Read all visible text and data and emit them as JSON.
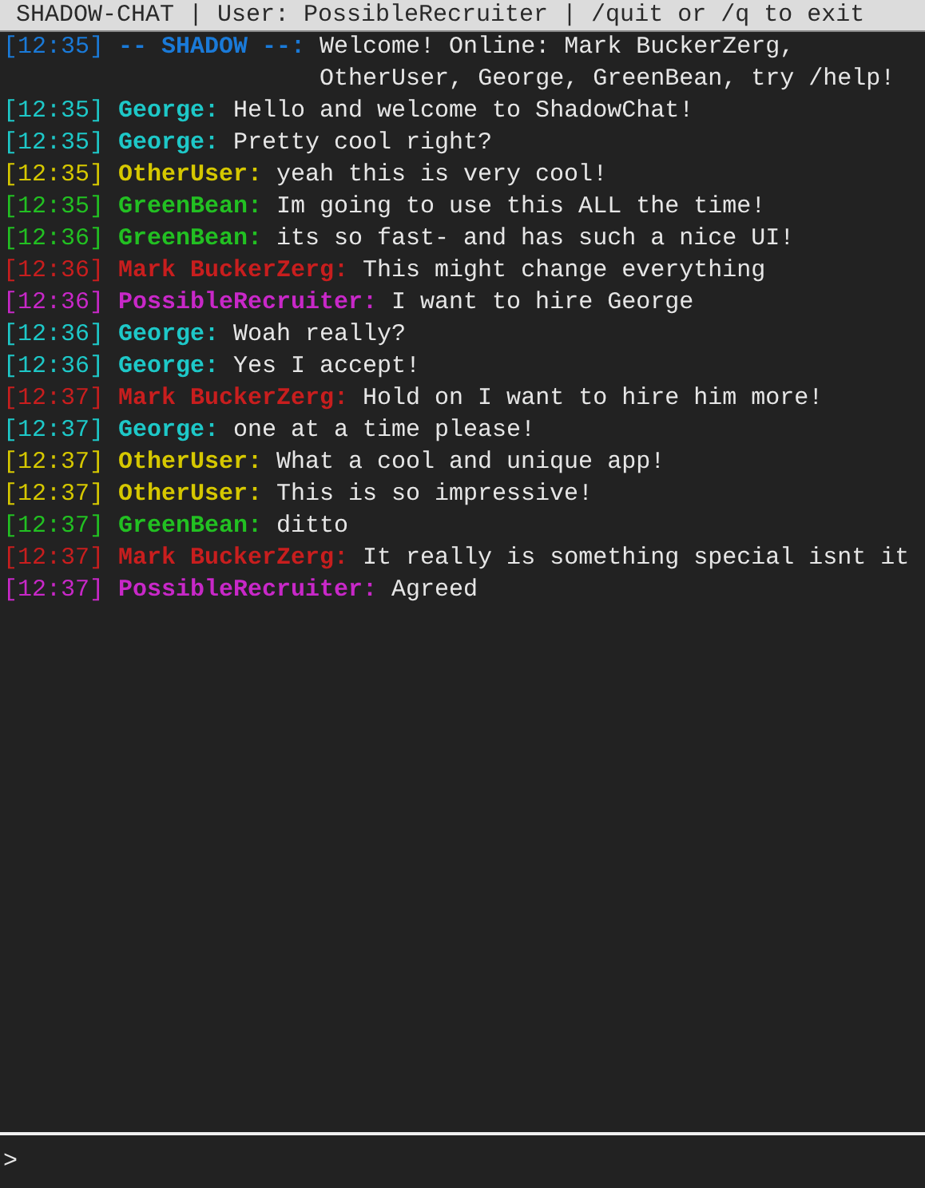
{
  "title_bar": "SHADOW-CHAT | User: PossibleRecruiter | /quit or /q to exit",
  "messages": [
    {
      "time": "[12:35]",
      "name": "-- SHADOW --:",
      "color": "#1a7ad8",
      "text": "Welcome! Online: Mark BuckerZerg, OtherUser, George, GreenBean, try /help!"
    },
    {
      "time": "[12:35]",
      "name": "George:",
      "color": "#1ec8c8",
      "text": "Hello and welcome to ShadowChat!"
    },
    {
      "time": "[12:35]",
      "name": "George:",
      "color": "#1ec8c8",
      "text": "Pretty cool right?"
    },
    {
      "time": "[12:35]",
      "name": "OtherUser:",
      "color": "#d6c800",
      "text": "yeah this is very cool!"
    },
    {
      "time": "[12:35]",
      "name": "GreenBean:",
      "color": "#22c022",
      "text": "Im going to use this ALL the time!"
    },
    {
      "time": "[12:36]",
      "name": "GreenBean:",
      "color": "#22c022",
      "text": "its so fast- and has such a nice UI!"
    },
    {
      "time": "[12:36]",
      "name": "Mark BuckerZerg:",
      "color": "#c81e1e",
      "text": "This might change everything"
    },
    {
      "time": "[12:36]",
      "name": "PossibleRecruiter:",
      "color": "#c828c8",
      "text": "I want to hire George"
    },
    {
      "time": "[12:36]",
      "name": "George:",
      "color": "#1ec8c8",
      "text": "Woah really?"
    },
    {
      "time": "[12:36]",
      "name": "George:",
      "color": "#1ec8c8",
      "text": "Yes I accept!"
    },
    {
      "time": "[12:37]",
      "name": "Mark BuckerZerg:",
      "color": "#c81e1e",
      "text": "Hold on I want to hire him more!"
    },
    {
      "time": "[12:37]",
      "name": "George:",
      "color": "#1ec8c8",
      "text": "one at a time please!"
    },
    {
      "time": "[12:37]",
      "name": "OtherUser:",
      "color": "#d6c800",
      "text": "What a cool and unique app!"
    },
    {
      "time": "[12:37]",
      "name": "OtherUser:",
      "color": "#d6c800",
      "text": "This is so impressive!"
    },
    {
      "time": "[12:37]",
      "name": "GreenBean:",
      "color": "#22c022",
      "text": "ditto"
    },
    {
      "time": "[12:37]",
      "name": "Mark BuckerZerg:",
      "color": "#c81e1e",
      "text": "It really is something special isnt it"
    },
    {
      "time": "[12:37]",
      "name": "PossibleRecruiter:",
      "color": "#c828c8",
      "text": "Agreed"
    }
  ],
  "prompt": ">"
}
